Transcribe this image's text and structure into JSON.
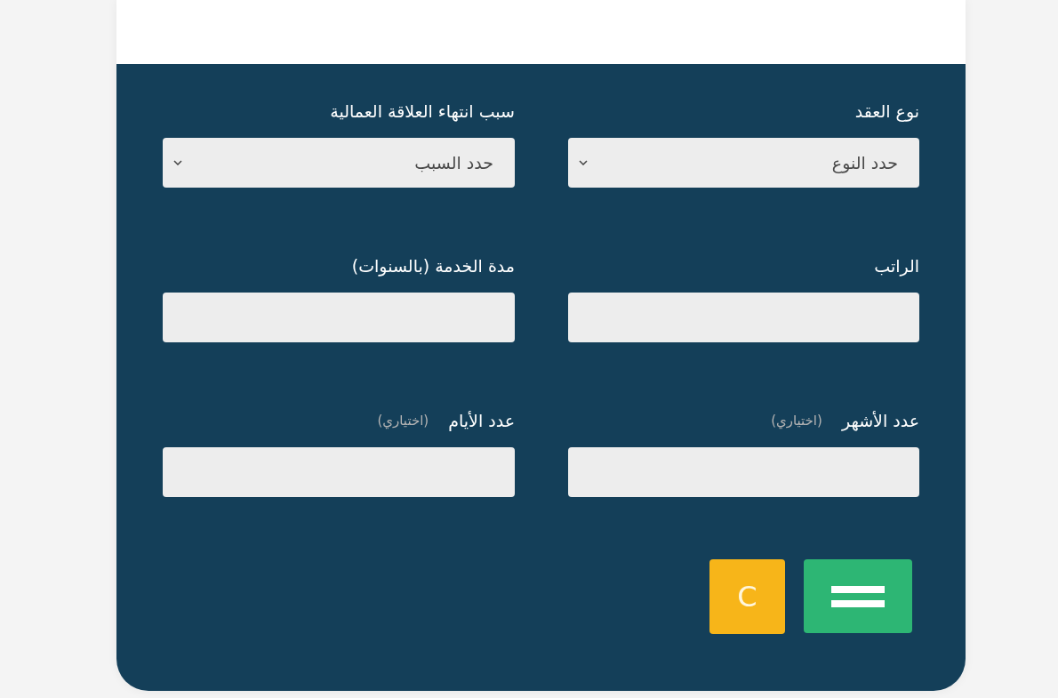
{
  "form": {
    "fields": [
      {
        "kind": "select",
        "label": "نوع العقد",
        "value": "حدد النوع"
      },
      {
        "kind": "select",
        "label": "سبب انتهاء العلاقة العمالية",
        "value": "حدد السبب"
      },
      {
        "kind": "input",
        "label": "الراتب"
      },
      {
        "kind": "input",
        "label": "مدة الخدمة (بالسنوات)"
      },
      {
        "kind": "input",
        "label": "عدد الأشهر",
        "note": "(اختياري)"
      },
      {
        "kind": "input",
        "label": "عدد الأيام",
        "note": "(اختياري)"
      }
    ],
    "buttons": [
      {
        "kind": "calculate"
      },
      {
        "kind": "clear",
        "label": "C"
      }
    ]
  }
}
